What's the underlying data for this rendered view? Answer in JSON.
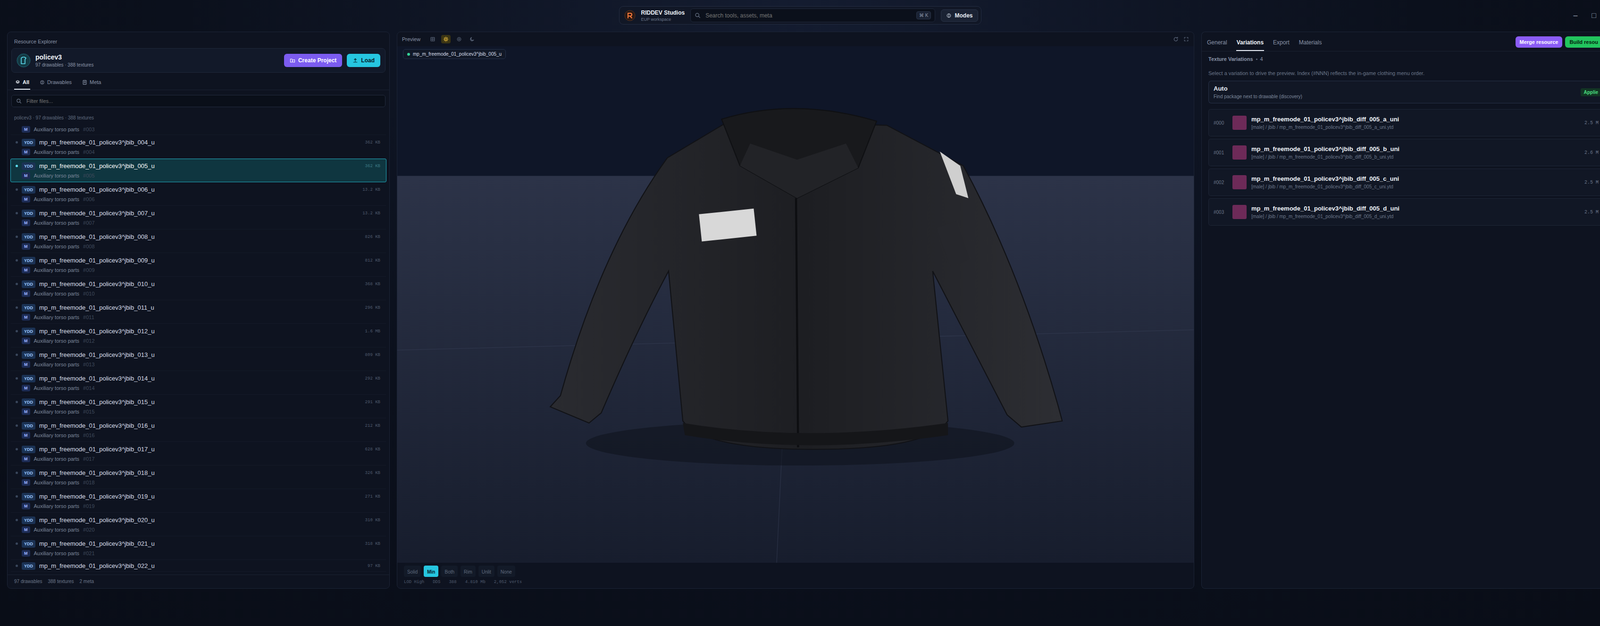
{
  "window": {
    "controls": [
      "–",
      "□"
    ]
  },
  "command_bar": {
    "brand": "RIDDEV Studios",
    "subtitle": "EUP workspace",
    "search": {
      "placeholder": "Search tools, assets, meta"
    },
    "shortcut": "⌘ K",
    "modes": "Modes"
  },
  "explorer": {
    "title": "Resource Explorer",
    "project": {
      "name": "policev3",
      "summary": "97 drawables · 388 textures"
    },
    "buttons": [
      "Create Project",
      "Load"
    ],
    "tabs": [
      {
        "label": "All",
        "selected": true
      },
      {
        "label": "Drawables",
        "selected": false
      },
      {
        "label": "Meta",
        "selected": false
      }
    ],
    "filter": {
      "placeholder": "Filter files..."
    },
    "breadcrumb": "policev3 · 97 drawables · 388 textures",
    "rows": [
      {
        "kind": "tail",
        "type": "M",
        "category": "Auxiliary torso parts",
        "index": "#003",
        "selected": false
      },
      {
        "kind": "full",
        "badge": "YDD",
        "name": "mp_m_freemode_01_policev3^jbib_004_u",
        "size": "362 KB",
        "type": "M",
        "category": "Auxiliary torso parts",
        "index": "#004",
        "selected": false
      },
      {
        "kind": "full",
        "badge": "YDD",
        "name": "mp_m_freemode_01_policev3^jbib_005_u",
        "size": "362 KB",
        "type": "M",
        "category": "Auxiliary torso parts",
        "index": "#005",
        "selected": true
      },
      {
        "kind": "full",
        "badge": "YDD",
        "name": "mp_m_freemode_01_policev3^jbib_006_u",
        "size": "13.2 KB",
        "type": "M",
        "category": "Auxiliary torso parts",
        "index": "#006",
        "selected": false
      },
      {
        "kind": "full",
        "badge": "YDD",
        "name": "mp_m_freemode_01_policev3^jbib_007_u",
        "size": "13.2 KB",
        "type": "M",
        "category": "Auxiliary torso parts",
        "index": "#007",
        "selected": false
      },
      {
        "kind": "full",
        "badge": "YDD",
        "name": "mp_m_freemode_01_policev3^jbib_008_u",
        "size": "826 KB",
        "type": "M",
        "category": "Auxiliary torso parts",
        "index": "#008",
        "selected": false
      },
      {
        "kind": "full",
        "badge": "YDD",
        "name": "mp_m_freemode_01_policev3^jbib_009_u",
        "size": "812 KB",
        "type": "M",
        "category": "Auxiliary torso parts",
        "index": "#009",
        "selected": false
      },
      {
        "kind": "full",
        "badge": "YDD",
        "name": "mp_m_freemode_01_policev3^jbib_010_u",
        "size": "368 KB",
        "type": "M",
        "category": "Auxiliary torso parts",
        "index": "#010",
        "selected": false
      },
      {
        "kind": "full",
        "badge": "YDD",
        "name": "mp_m_freemode_01_policev3^jbib_011_u",
        "size": "296 KB",
        "type": "M",
        "category": "Auxiliary torso parts",
        "index": "#011",
        "selected": false
      },
      {
        "kind": "full",
        "badge": "YDD",
        "name": "mp_m_freemode_01_policev3^jbib_012_u",
        "size": "1.6 MB",
        "type": "M",
        "category": "Auxiliary torso parts",
        "index": "#012",
        "selected": false
      },
      {
        "kind": "full",
        "badge": "YDD",
        "name": "mp_m_freemode_01_policev3^jbib_013_u",
        "size": "809 KB",
        "type": "M",
        "category": "Auxiliary torso parts",
        "index": "#013",
        "selected": false
      },
      {
        "kind": "full",
        "badge": "YDD",
        "name": "mp_m_freemode_01_policev3^jbib_014_u",
        "size": "292 KB",
        "type": "M",
        "category": "Auxiliary torso parts",
        "index": "#014",
        "selected": false
      },
      {
        "kind": "full",
        "badge": "YDD",
        "name": "mp_m_freemode_01_policev3^jbib_015_u",
        "size": "291 KB",
        "type": "M",
        "category": "Auxiliary torso parts",
        "index": "#015",
        "selected": false
      },
      {
        "kind": "full",
        "badge": "YDD",
        "name": "mp_m_freemode_01_policev3^jbib_016_u",
        "size": "212 KB",
        "type": "M",
        "category": "Auxiliary torso parts",
        "index": "#016",
        "selected": false
      },
      {
        "kind": "full",
        "badge": "YDD",
        "name": "mp_m_freemode_01_policev3^jbib_017_u",
        "size": "628 KB",
        "type": "M",
        "category": "Auxiliary torso parts",
        "index": "#017",
        "selected": false
      },
      {
        "kind": "full",
        "badge": "YDD",
        "name": "mp_m_freemode_01_policev3^jbib_018_u",
        "size": "326 KB",
        "type": "M",
        "category": "Auxiliary torso parts",
        "index": "#018",
        "selected": false
      },
      {
        "kind": "full",
        "badge": "YDD",
        "name": "mp_m_freemode_01_policev3^jbib_019_u",
        "size": "271 KB",
        "type": "M",
        "category": "Auxiliary torso parts",
        "index": "#019",
        "selected": false
      },
      {
        "kind": "full",
        "badge": "YDD",
        "name": "mp_m_freemode_01_policev3^jbib_020_u",
        "size": "310 KB",
        "type": "M",
        "category": "Auxiliary torso parts",
        "index": "#020",
        "selected": false
      },
      {
        "kind": "full",
        "badge": "YDD",
        "name": "mp_m_freemode_01_policev3^jbib_021_u",
        "size": "318 KB",
        "type": "M",
        "category": "Auxiliary torso parts",
        "index": "#021",
        "selected": false
      },
      {
        "kind": "head",
        "badge": "YDD",
        "name": "mp_m_freemode_01_policev3^jbib_022_u",
        "size": "97 KB",
        "selected": false
      }
    ],
    "footer": [
      "97 drawables",
      "388 textures",
      "2 meta"
    ]
  },
  "preview": {
    "title": "Preview",
    "tools": [
      {
        "selected": false
      },
      {
        "selected": true
      },
      {
        "selected": false
      },
      {
        "selected": false
      }
    ],
    "chip": "mp_m_freemode_01_policev3^jbib_005_u",
    "modes": [
      {
        "label": "Solid",
        "selected": false
      },
      {
        "label": "Min",
        "selected": true
      },
      {
        "label": "Both",
        "selected": false
      },
      {
        "label": "Rim",
        "selected": false
      },
      {
        "label": "Unlit",
        "selected": false
      },
      {
        "label": "None",
        "selected": false
      }
    ],
    "stats": [
      "LOD High",
      "DDS",
      "388",
      "4.810 Mb",
      "2,052 verts"
    ]
  },
  "inspector": {
    "tabs": [
      {
        "label": "General",
        "selected": false
      },
      {
        "label": "Variations",
        "selected": true
      },
      {
        "label": "Export",
        "selected": false
      },
      {
        "label": "Materials",
        "selected": false
      }
    ],
    "actions": [
      "Merge resource",
      "Build resou"
    ],
    "section": "Texture Variations",
    "count": "4",
    "description": "Select a variation to drive the preview. Index (#NNN) reflects the in-game clothing menu order.",
    "auto": {
      "title": "Auto",
      "detail": "Find package next to drawable (discovery)",
      "badge": "Applie"
    },
    "variations": [
      {
        "index": "#000",
        "name": "mp_m_freemode_01_policev3^jbib_diff_005_a_uni",
        "path": "[male] / jbib / mp_m_freemode_01_policev3^jbib_diff_005_a_uni.ytd",
        "size": "2.5 M"
      },
      {
        "index": "#001",
        "name": "mp_m_freemode_01_policev3^jbib_diff_005_b_uni",
        "path": "[male] / jbib / mp_m_freemode_01_policev3^jbib_diff_005_b_uni.ytd",
        "size": "2.6 M"
      },
      {
        "index": "#002",
        "name": "mp_m_freemode_01_policev3^jbib_diff_005_c_uni",
        "path": "[male] / jbib / mp_m_freemode_01_policev3^jbib_diff_005_c_uni.ytd",
        "size": "2.5 M"
      },
      {
        "index": "#003",
        "name": "mp_m_freemode_01_policev3^jbib_diff_005_d_uni",
        "path": "[male] / jbib / mp_m_freemode_01_policev3^jbib_diff_005_d_uni.ytd",
        "size": "2.5 M"
      }
    ]
  }
}
